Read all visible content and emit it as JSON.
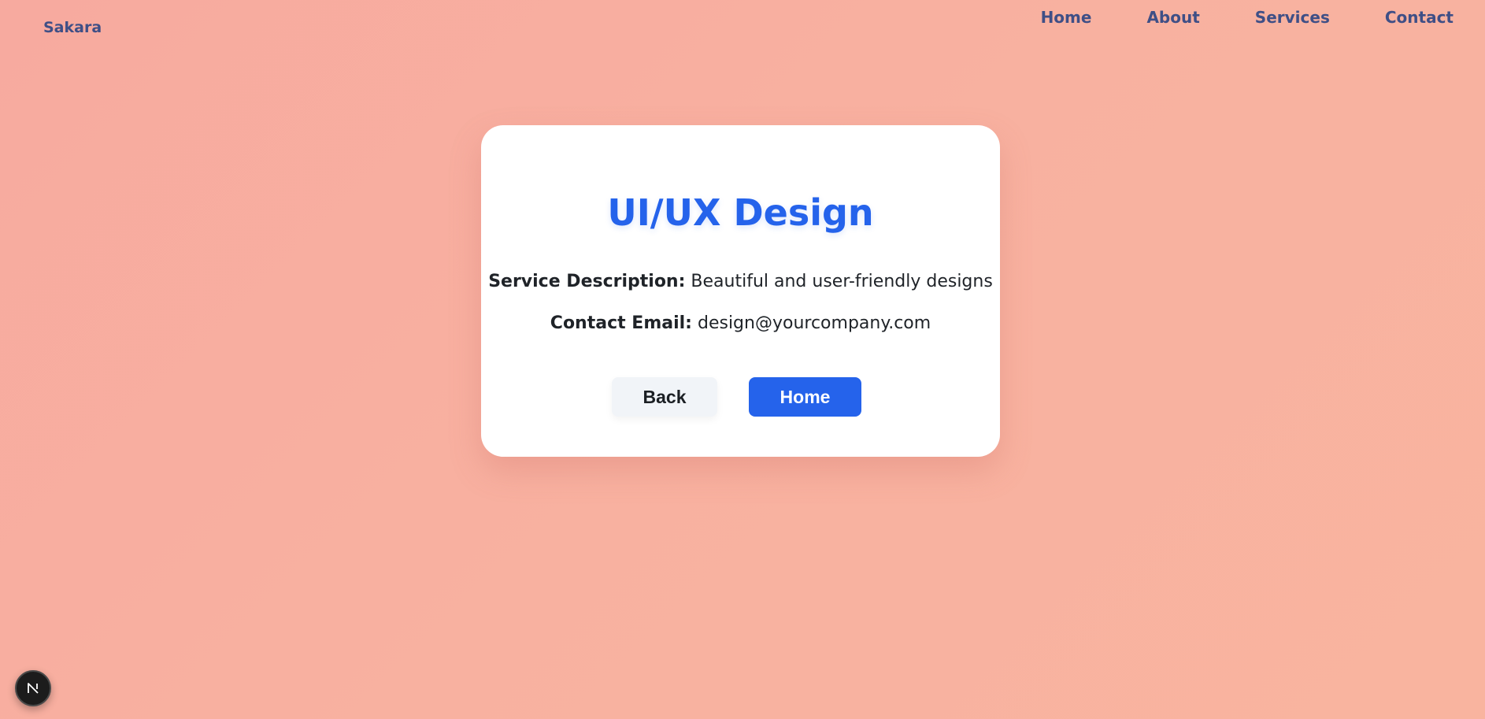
{
  "brand": {
    "name": "Sakara"
  },
  "nav": {
    "home": "Home",
    "about": "About",
    "services": "Services",
    "contact": "Contact"
  },
  "card": {
    "title": "UI/UX Design",
    "description_label": "Service Description:",
    "description_value": "Beautiful and user-friendly designs",
    "email_label": "Contact Email:",
    "email_value": "design@yourcompany.com",
    "back_button": "Back",
    "home_button": "Home"
  },
  "badge": {
    "icon": "nextjs-logo-icon"
  },
  "colors": {
    "accent": "#2563eb",
    "nav_text": "#3f4f86",
    "background": "#f8b1a0"
  }
}
